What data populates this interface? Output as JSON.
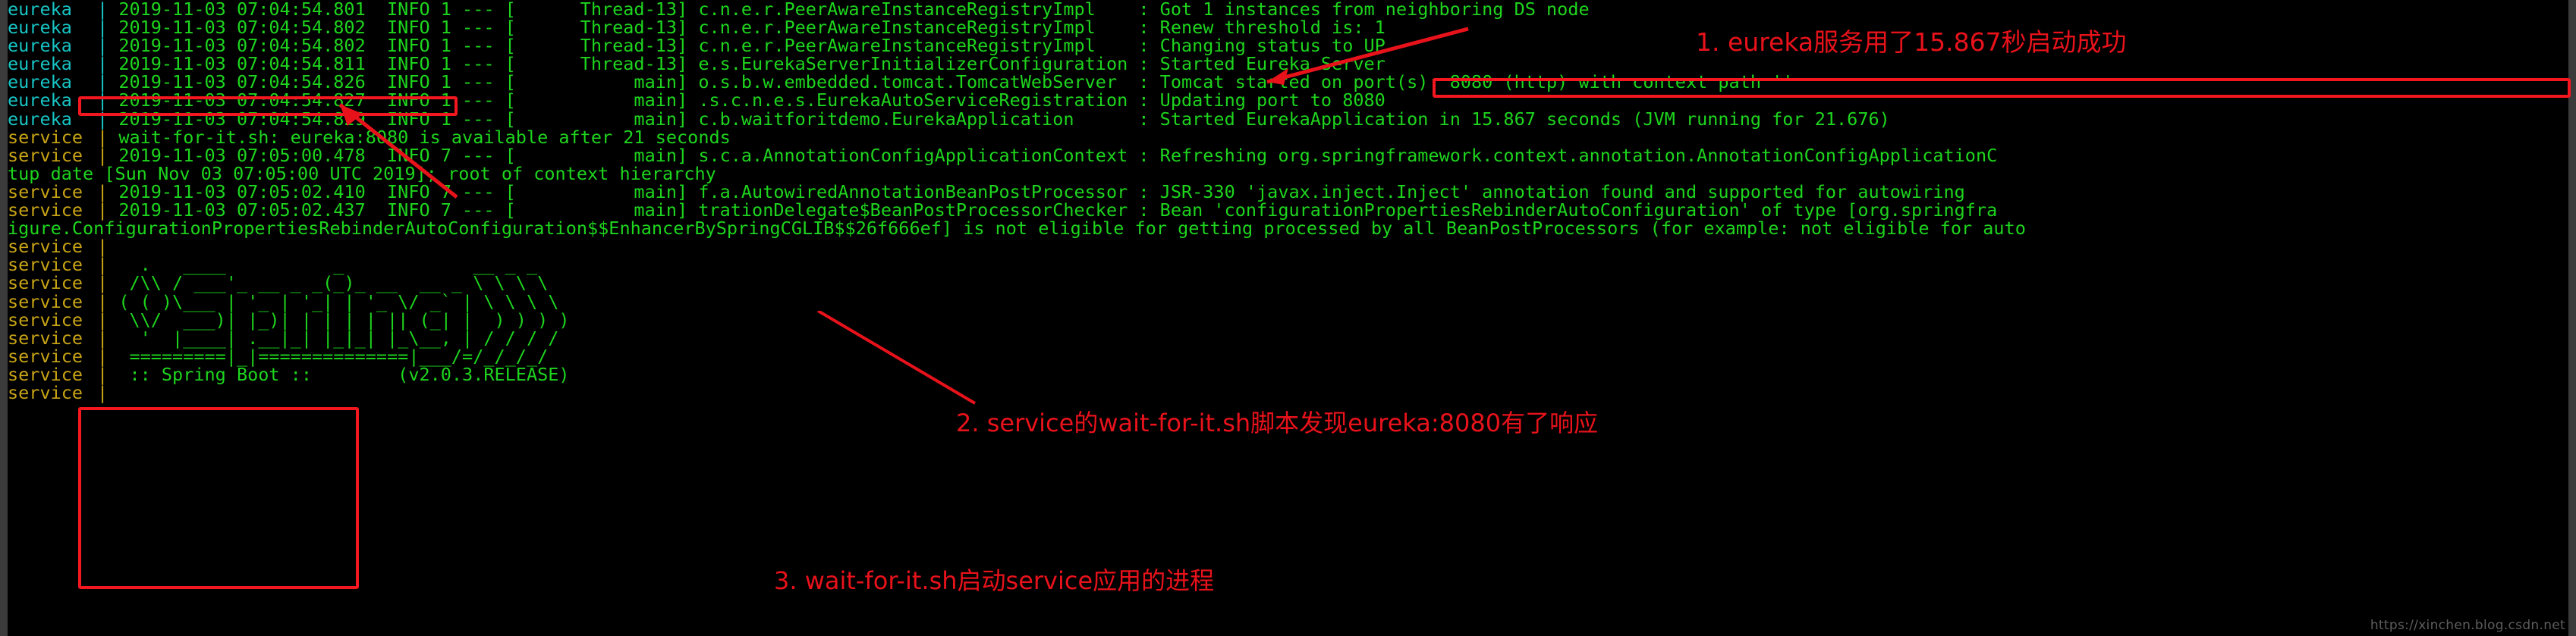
{
  "terminal": {
    "colors": {
      "background": "#000000",
      "eureka_label": "#17c4c4",
      "service_label": "#c8a415",
      "log_text": "#1ed51e",
      "annotation_red": "#e8121b",
      "box_red": "#f5171f",
      "watermark": "#5d5d5d"
    },
    "lines": [
      {
        "svc": "eureka",
        "sep": "|",
        "text": "2019-11-03 07:04:54.801  INFO 1 --- [      Thread-13] c.n.e.r.PeerAwareInstanceRegistryImpl    : Got 1 instances from neighboring DS node"
      },
      {
        "svc": "eureka",
        "sep": "|",
        "text": "2019-11-03 07:04:54.802  INFO 1 --- [      Thread-13] c.n.e.r.PeerAwareInstanceRegistryImpl    : Renew threshold is: 1"
      },
      {
        "svc": "eureka",
        "sep": "|",
        "text": "2019-11-03 07:04:54.802  INFO 1 --- [      Thread-13] c.n.e.r.PeerAwareInstanceRegistryImpl    : Changing status to UP"
      },
      {
        "svc": "eureka",
        "sep": "|",
        "text": "2019-11-03 07:04:54.811  INFO 1 --- [      Thread-13] e.s.EurekaServerInitializerConfiguration : Started Eureka Server"
      },
      {
        "svc": "eureka",
        "sep": "|",
        "text": "2019-11-03 07:04:54.826  INFO 1 --- [           main] o.s.b.w.embedded.tomcat.TomcatWebServer  : Tomcat started on port(s): 8080 (http) with context path ''"
      },
      {
        "svc": "eureka",
        "sep": "|",
        "text": "2019-11-03 07:04:54.827  INFO 1 --- [           main] .s.c.n.e.s.EurekaAutoServiceRegistration : Updating port to 8080"
      },
      {
        "svc": "eureka",
        "sep": "|",
        "text": "2019-11-03 07:04:54.829  INFO 1 --- [           main] c.b.waitforitdemo.EurekaApplication      : Started EurekaApplication in 15.867 seconds (JVM running for 21.676)"
      },
      {
        "svc": "service",
        "sep": "|",
        "text": "wait-for-it.sh: eureka:8080 is available after 21 seconds"
      },
      {
        "svc": "service",
        "sep": "|",
        "text": "2019-11-03 07:05:00.478  INFO 7 --- [           main] s.c.a.AnnotationConfigApplicationContext : Refreshing org.springframework.context.annotation.AnnotationConfigApplicationC"
      },
      {
        "svc": "",
        "sep": "",
        "text": "tup date [Sun Nov 03 07:05:00 UTC 2019]; root of context hierarchy"
      },
      {
        "svc": "service",
        "sep": "|",
        "text": "2019-11-03 07:05:02.410  INFO 7 --- [           main] f.a.AutowiredAnnotationBeanPostProcessor : JSR-330 'javax.inject.Inject' annotation found and supported for autowiring"
      },
      {
        "svc": "service",
        "sep": "|",
        "text": "2019-11-03 07:05:02.437  INFO 7 --- [           main] trationDelegate$BeanPostProcessorChecker : Bean 'configurationPropertiesRebinderAutoConfiguration' of type [org.springfra"
      },
      {
        "svc": "",
        "sep": "",
        "text": "igure.ConfigurationPropertiesRebinderAutoConfiguration$$EnhancerBySpringCGLIB$$26f666ef] is not eligible for getting processed by all BeanPostProcessors (for example: not eligible for auto"
      },
      {
        "svc": "service",
        "sep": "|",
        "text": ""
      },
      {
        "svc": "service",
        "sep": "|",
        "text": "  .   ____          _            __ _ _"
      },
      {
        "svc": "service",
        "sep": "|",
        "text": " /\\\\ / ___'_ __ _ _(_)_ __  __ _ \\ \\ \\ \\"
      },
      {
        "svc": "service",
        "sep": "|",
        "text": "( ( )\\___ | '_ | '_| | '_ \\/ _` | \\ \\ \\ \\"
      },
      {
        "svc": "service",
        "sep": "|",
        "text": " \\\\/  ___)| |_)| | | | | || (_| |  ) ) ) )"
      },
      {
        "svc": "service",
        "sep": "|",
        "text": "  '  |____| .__|_| |_|_| |_\\__, | / / / /"
      },
      {
        "svc": "service",
        "sep": "|",
        "text": " =========|_|==============|___/=/_/_/_/"
      },
      {
        "svc": "service",
        "sep": "|",
        "text": " :: Spring Boot ::        (v2.0.3.RELEASE)"
      },
      {
        "svc": "service",
        "sep": "|",
        "text": ""
      }
    ]
  },
  "annotations": {
    "note1": "1. eureka服务用了15.867秒启动成功",
    "note2": "2. service的wait-for-it.sh脚本发现eureka:8080有了响应",
    "note3": "3. wait-for-it.sh启动service应用的进程"
  },
  "watermark": "https://xinchen.blog.csdn.net"
}
